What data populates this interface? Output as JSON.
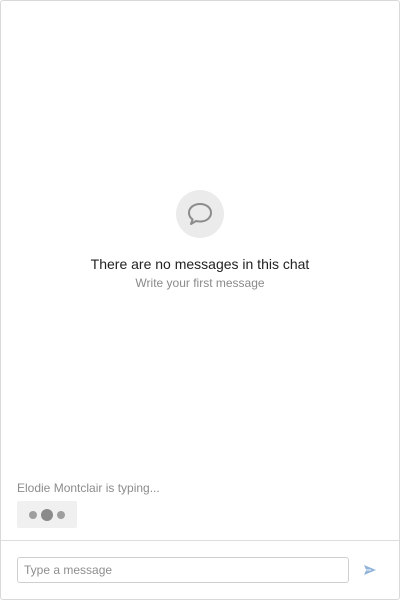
{
  "empty_state": {
    "title": "There are no messages in this chat",
    "subtitle": "Write your first message",
    "icon": "chat-bubble-icon"
  },
  "typing": {
    "text": "Elodie Montclair is typing..."
  },
  "composer": {
    "placeholder": "Type a message",
    "value": "",
    "send_icon": "send-icon"
  },
  "colors": {
    "accent": "#8fb3d9",
    "icon_gray": "#8c8c8c",
    "border": "#d9d9d9"
  }
}
